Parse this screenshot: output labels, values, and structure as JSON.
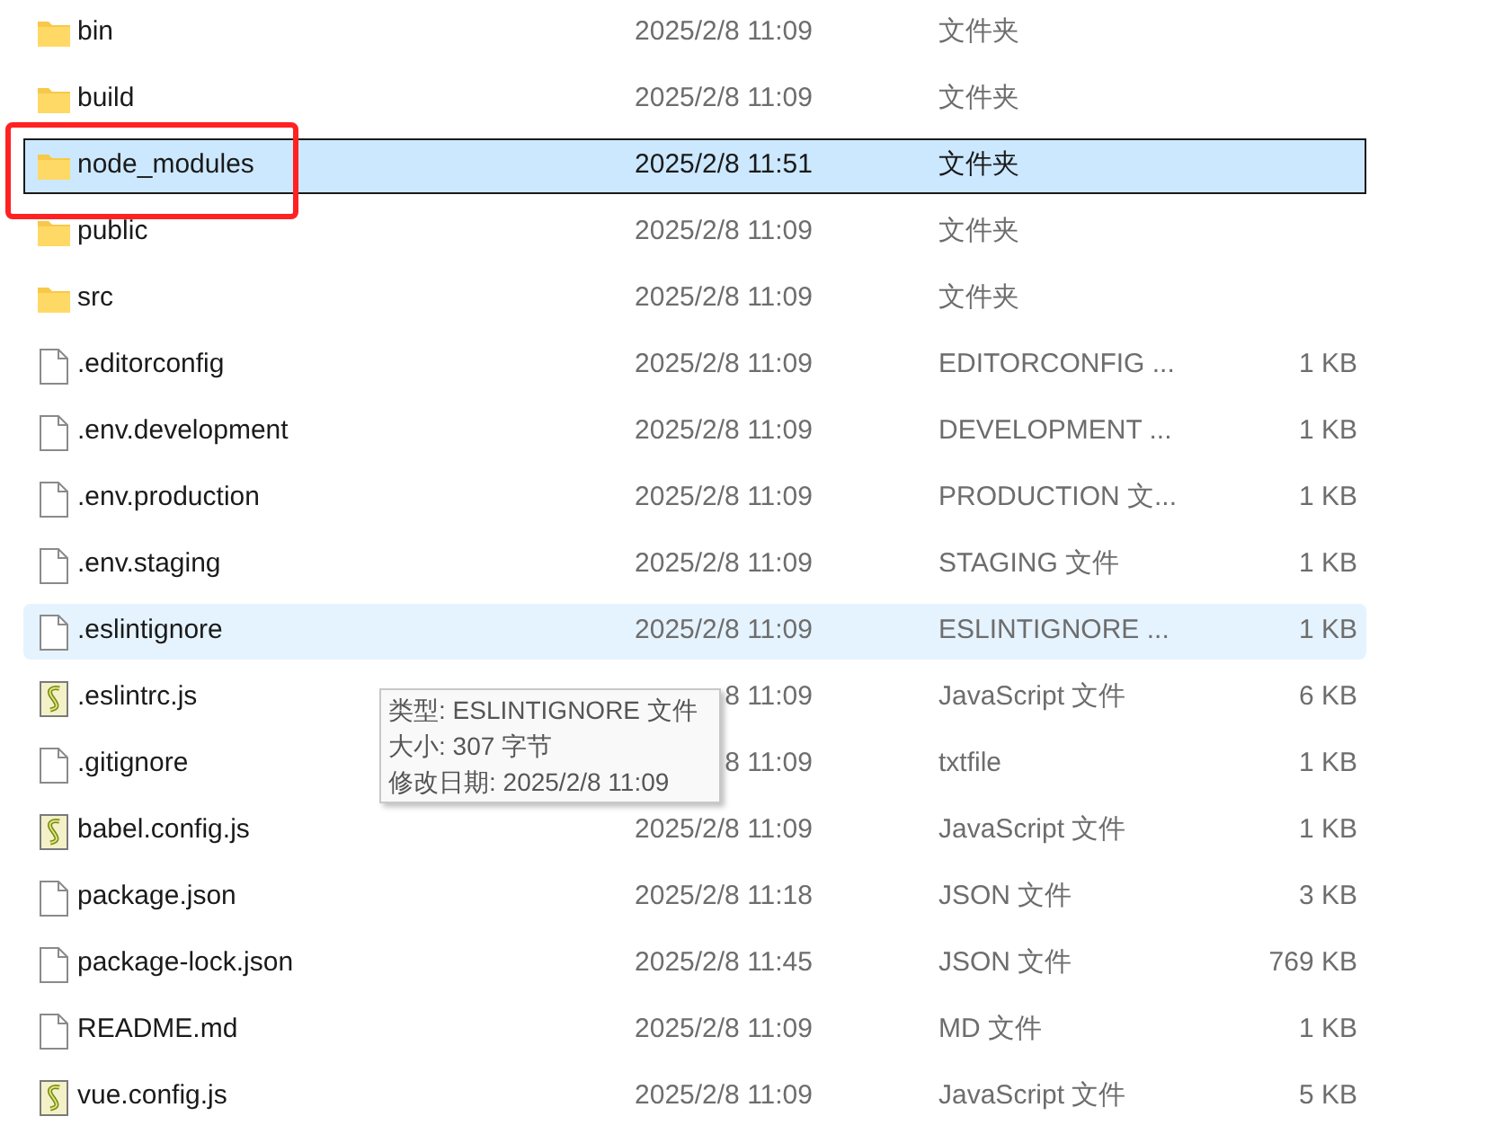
{
  "files": [
    {
      "kind": "folder",
      "name": "bin",
      "date": "2025/2/8 11:09",
      "type": "文件夹",
      "selected": false,
      "hovered": false
    },
    {
      "kind": "folder",
      "name": "build",
      "date": "2025/2/8 11:09",
      "type": "文件夹",
      "selected": false,
      "hovered": false
    },
    {
      "kind": "folder",
      "name": "node_modules",
      "date": "2025/2/8 11:51",
      "type": "文件夹",
      "selected": true,
      "hovered": false
    },
    {
      "kind": "folder",
      "name": "public",
      "date": "2025/2/8 11:09",
      "type": "文件夹",
      "selected": false,
      "hovered": false
    },
    {
      "kind": "folder",
      "name": "src",
      "date": "2025/2/8 11:09",
      "type": "文件夹",
      "selected": false,
      "hovered": false
    },
    {
      "kind": "file",
      "name": ".editorconfig",
      "date": "2025/2/8 11:09",
      "type": "EDITORCONFIG ...",
      "size": "1 KB",
      "selected": false,
      "hovered": false
    },
    {
      "kind": "file",
      "name": ".env.development",
      "date": "2025/2/8 11:09",
      "type": "DEVELOPMENT ...",
      "size": "1 KB",
      "selected": false,
      "hovered": false
    },
    {
      "kind": "file",
      "name": ".env.production",
      "date": "2025/2/8 11:09",
      "type": "PRODUCTION 文...",
      "size": "1 KB",
      "selected": false,
      "hovered": false
    },
    {
      "kind": "file",
      "name": ".env.staging",
      "date": "2025/2/8 11:09",
      "type": "STAGING 文件",
      "size": "1 KB",
      "selected": false,
      "hovered": false
    },
    {
      "kind": "file",
      "name": ".eslintignore",
      "date": "2025/2/8 11:09",
      "type": "ESLINTIGNORE ...",
      "size": "1 KB",
      "selected": false,
      "hovered": true
    },
    {
      "kind": "script",
      "name": ".eslintrc.js",
      "date": "8 11:09",
      "type": "JavaScript 文件",
      "size": "6 KB",
      "selected": false,
      "hovered": false
    },
    {
      "kind": "file",
      "name": ".gitignore",
      "date": "8 11:09",
      "type": "txtfile",
      "size": "1 KB",
      "selected": false,
      "hovered": false
    },
    {
      "kind": "script",
      "name": "babel.config.js",
      "date": "2025/2/8 11:09",
      "type": "JavaScript 文件",
      "size": "1 KB",
      "selected": false,
      "hovered": false
    },
    {
      "kind": "file",
      "name": "package.json",
      "date": "2025/2/8 11:18",
      "type": "JSON 文件",
      "size": "3 KB",
      "selected": false,
      "hovered": false
    },
    {
      "kind": "file",
      "name": "package-lock.json",
      "date": "2025/2/8 11:45",
      "type": "JSON 文件",
      "size": "769 KB",
      "selected": false,
      "hovered": false
    },
    {
      "kind": "file",
      "name": "README.md",
      "date": "2025/2/8 11:09",
      "type": "MD 文件",
      "size": "1 KB",
      "selected": false,
      "hovered": false
    },
    {
      "kind": "script",
      "name": "vue.config.js",
      "date": "2025/2/8 11:09",
      "type": "JavaScript 文件",
      "size": "5 KB",
      "selected": false,
      "hovered": false
    }
  ],
  "tooltip": {
    "lines": [
      "类型: ESLINTIGNORE 文件",
      "大小: 307 字节",
      "修改日期: 2025/2/8 11:09"
    ]
  }
}
